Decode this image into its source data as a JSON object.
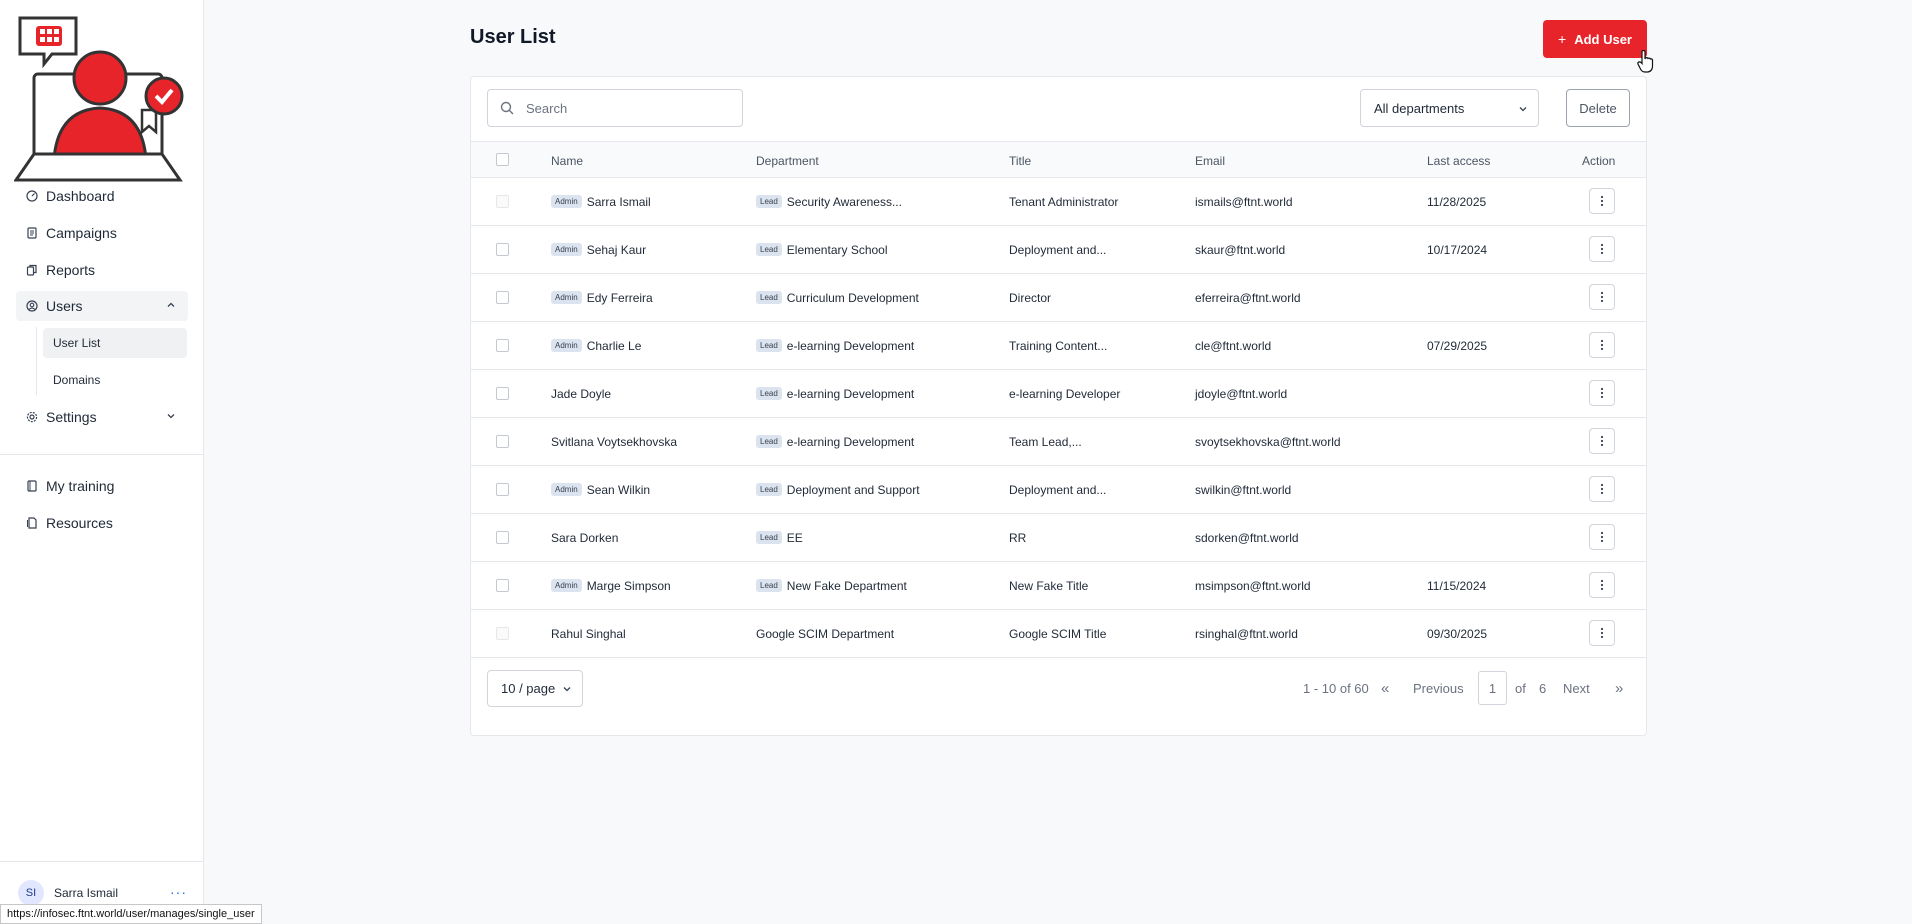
{
  "colors": {
    "accent": "#e8242b",
    "badge_bg": "#dbe3ee",
    "link": "#2563eb"
  },
  "sidebar": {
    "logo_icon": "security-awareness-logo",
    "items": [
      {
        "label": "Dashboard",
        "icon": "gauge-icon"
      },
      {
        "label": "Campaigns",
        "icon": "document-icon"
      },
      {
        "label": "Reports",
        "icon": "copy-icon"
      },
      {
        "label": "Users",
        "icon": "user-circle-icon"
      },
      {
        "label": "Settings",
        "icon": "gear-icon"
      },
      {
        "label": "My training",
        "icon": "book-icon"
      },
      {
        "label": "Resources",
        "icon": "files-icon"
      }
    ],
    "users_subitems": [
      {
        "label": "User List"
      },
      {
        "label": "Domains"
      }
    ],
    "profile": {
      "initials": "SI",
      "name": "Sarra Ismail",
      "more": "···"
    }
  },
  "status_url": "https://infosec.ftnt.world/user/manages/single_user",
  "header": {
    "title": "User List",
    "add_button": "Add User",
    "add_icon": "+"
  },
  "filters": {
    "search_placeholder": "Search",
    "department_selected": "All departments",
    "delete_label": "Delete"
  },
  "table": {
    "columns": [
      "Name",
      "Department",
      "Title",
      "Email",
      "Last access",
      "Action"
    ],
    "rows": [
      {
        "role": "Admin",
        "name": "Sarra Ismail",
        "dept_badge": "Lead",
        "department": "Security Awareness...",
        "title": "Tenant Administrator",
        "email": "ismails@ftnt.world",
        "last_access": "11/28/2025"
      },
      {
        "role": "Admin",
        "name": "Sehaj Kaur",
        "dept_badge": "Lead",
        "department": "Elementary School",
        "title": "Deployment and...",
        "email": "skaur@ftnt.world",
        "last_access": "10/17/2024"
      },
      {
        "role": "Admin",
        "name": "Edy Ferreira",
        "dept_badge": "Lead",
        "department": "Curriculum Development",
        "title": "Director",
        "email": "eferreira@ftnt.world",
        "last_access": ""
      },
      {
        "role": "Admin",
        "name": "Charlie Le",
        "dept_badge": "Lead",
        "department": "e-learning Development",
        "title": "Training Content...",
        "email": "cle@ftnt.world",
        "last_access": "07/29/2025"
      },
      {
        "role": "",
        "name": "Jade Doyle",
        "dept_badge": "Lead",
        "department": "e-learning Development",
        "title": "e-learning Developer",
        "email": "jdoyle@ftnt.world",
        "last_access": ""
      },
      {
        "role": "",
        "name": "Svitlana Voytsekhovska",
        "dept_badge": "Lead",
        "department": "e-learning Development",
        "title": "Team Lead,...",
        "email": "svoytsekhovska@ftnt.world",
        "last_access": ""
      },
      {
        "role": "Admin",
        "name": "Sean Wilkin",
        "dept_badge": "Lead",
        "department": "Deployment and Support",
        "title": "Deployment and...",
        "email": "swilkin@ftnt.world",
        "last_access": ""
      },
      {
        "role": "",
        "name": "Sara Dorken",
        "dept_badge": "Lead",
        "department": "EE",
        "title": "RR",
        "email": "sdorken@ftnt.world",
        "last_access": ""
      },
      {
        "role": "Admin",
        "name": "Marge Simpson",
        "dept_badge": "Lead",
        "department": "New Fake Department",
        "title": "New Fake Title",
        "email": "msimpson@ftnt.world",
        "last_access": "11/15/2024"
      },
      {
        "role": "",
        "name": "Rahul Singhal",
        "dept_badge": "",
        "department": "Google SCIM Department",
        "title": "Google SCIM Title",
        "email": "rsinghal@ftnt.world",
        "last_access": "09/30/2025"
      }
    ]
  },
  "pagination": {
    "per_page": "10 / page",
    "range": "1 - 10 of 60",
    "previous": "Previous",
    "current_page": "1",
    "of": "of",
    "total_pages": "6",
    "next": "Next",
    "first_icon": "«",
    "last_icon": "»"
  }
}
